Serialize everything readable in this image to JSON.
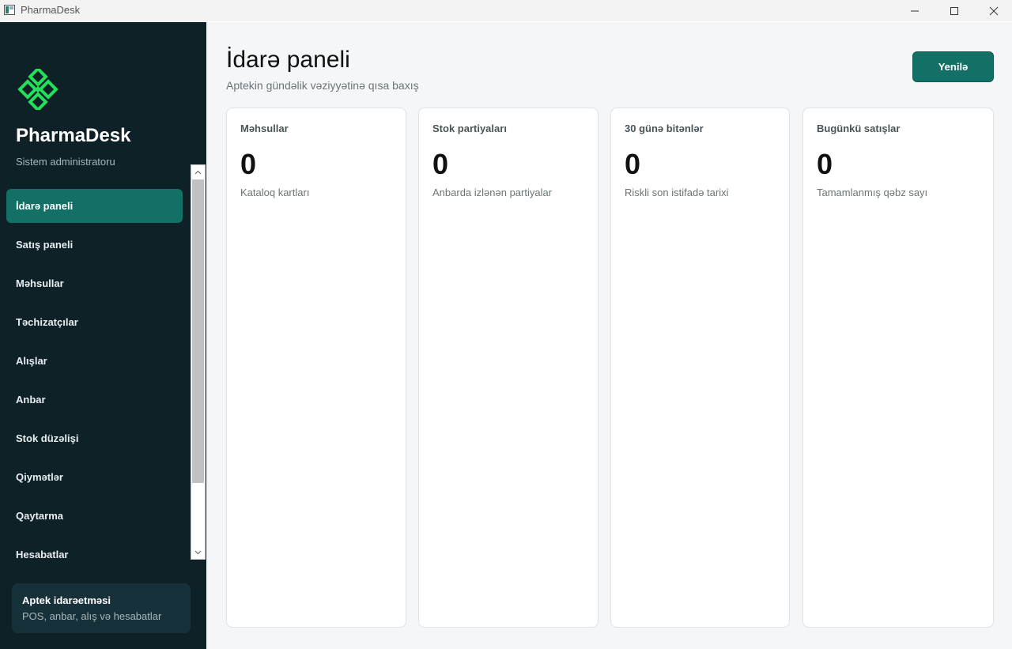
{
  "window": {
    "title": "PharmaDesk"
  },
  "sidebar": {
    "brand": "PharmaDesk",
    "role": "Sistem administratoru",
    "items": [
      {
        "label": "İdarə paneli",
        "active": true
      },
      {
        "label": "Satış paneli"
      },
      {
        "label": "Məhsullar"
      },
      {
        "label": "Təchizatçılar"
      },
      {
        "label": "Alışlar"
      },
      {
        "label": "Anbar"
      },
      {
        "label": "Stok düzəlişi"
      },
      {
        "label": "Qiymətlər"
      },
      {
        "label": "Qaytarma"
      },
      {
        "label": "Hesabatlar"
      }
    ],
    "info": {
      "title": "Aptek idarəetməsi",
      "subtitle": "POS, anbar, alış və hesabatlar"
    }
  },
  "main": {
    "title": "İdarə paneli",
    "subtitle": "Aptekin gündəlik vəziyyətinə qısa baxış",
    "refresh_label": "Yenilə",
    "cards": [
      {
        "label": "Məhsullar",
        "value": "0",
        "sub": "Kataloq kartları"
      },
      {
        "label": "Stok partiyaları",
        "value": "0",
        "sub": "Anbarda izlənən partiyalar"
      },
      {
        "label": "30 günə bitənlər",
        "value": "0",
        "sub": "Riskli son istifadə tarixi"
      },
      {
        "label": "Bugünkü satışlar",
        "value": "0",
        "sub": "Tamamlanmış qəbz sayı"
      }
    ]
  },
  "colors": {
    "sidebar_bg": "#0e2127",
    "accent": "#137067",
    "logo_green": "#22e05a",
    "main_bg": "#f4f6f8"
  },
  "icons": {
    "app": "app-icon",
    "logo": "pharmadesk-logo",
    "minimize": "minimize-icon",
    "maximize": "maximize-icon",
    "close": "close-icon"
  }
}
